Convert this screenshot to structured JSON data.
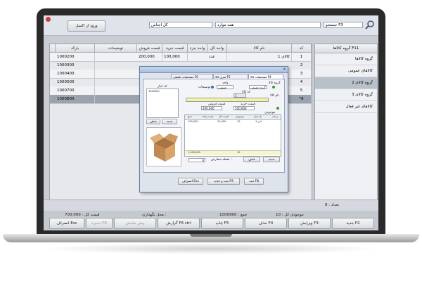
{
  "toolbar": {
    "search_placeholder": "جستجو F3",
    "group_select": "همه موارد",
    "filter_label": "کل اجناس",
    "list_label": "ورود از اکسل"
  },
  "table": {
    "columns": [
      "کد",
      "نام کالا",
      "واحد کل",
      "واحد جزء",
      "قیمت خرید",
      "قیمت فروش",
      "توضیحات",
      "بارکد"
    ],
    "rows": [
      {
        "code": "1",
        "name": "کالای 1",
        "unit": "عدد",
        "buy": "100,000",
        "sell": "200,000",
        "barcode": "1000200"
      },
      {
        "code": "2",
        "name": "",
        "unit": "",
        "buy": "",
        "sell": "",
        "barcode": "1000300"
      },
      {
        "code": "3",
        "name": "",
        "unit": "",
        "buy": "",
        "sell": "",
        "barcode": "1000400"
      },
      {
        "code": "4",
        "name": "",
        "unit": "",
        "buy": "",
        "sell": "",
        "barcode": "1000500"
      },
      {
        "code": "5",
        "name": "",
        "unit": "",
        "buy": "",
        "sell": "",
        "barcode": "1000700"
      },
      {
        "code": "*8",
        "name": "",
        "unit": "",
        "buy": "",
        "sell": "",
        "barcode": "1000800"
      }
    ]
  },
  "sidebar": {
    "header": "گروه کالاها F11",
    "items": [
      "گروه کالاها",
      "کالاهای عمومی",
      "گروه کالای 2",
      "گروه کالای 3",
      "کالاهای غیر فعال"
    ]
  },
  "status": {
    "count": "تعداد : 8",
    "items": [
      "موجودی کل : 10",
      "جمع : 1000900",
      "محل نگهداری :",
      "قیمت کل : 700,000",
      "موجودی نوع : 10"
    ]
  },
  "buttons": {
    "new": "جدید F2",
    "edit": "ویرایش F3",
    "delete": "حذف F4",
    "print": "چاپ F5",
    "refresh": "گزارش F6 ctrl",
    "fav": "ذخیره F8",
    "view": "پیش نمایش",
    "exit": "انصراف Esc"
  },
  "dialog": {
    "tabs": [
      "مشخصات کالا F4",
      "سری کالا F5",
      "مشخصات تکمیلی F6"
    ],
    "labels": {
      "code": "کد کالا",
      "group": "گروه کالا",
      "name": "نام کالا",
      "buy_price": "قیمت خرید",
      "sell_price": "قیمت فروش",
      "barcode": "بارکد",
      "unit": "واحد",
      "desc": "توضیحات",
      "list_header": "کد انبار",
      "qty_label": "نقطه سفارش :",
      "rows_header": "موجودی",
      "tbl_cols": [
        "ردیف",
        "نام انبار",
        "موجودی",
        "قیمت کل",
        "قیمت واحد",
        "جمع"
      ]
    },
    "values": {
      "code": "1",
      "group": "گروه عمومی",
      "unit": "عمومی",
      "buy": "100,000",
      "sell": "200,000",
      "store": "انبار 1",
      "qty": "10",
      "price": "10,000",
      "unitp": "100,000",
      "sum": "1,000,000",
      "total": "1,000,000",
      "min": "0",
      "list_val": "1000000"
    },
    "buttons": {
      "save": "ثبت F8",
      "save_new": "ثبت و جدید F9",
      "cancel": "انصراف Esc",
      "add": "جدید",
      "del": "حذف",
      "add2": "جدید",
      "del2": "حذف"
    }
  },
  "colors": {
    "accent": "#3a6fb0",
    "highlight": "#f4f29a",
    "selected": "#9aa3ae"
  }
}
